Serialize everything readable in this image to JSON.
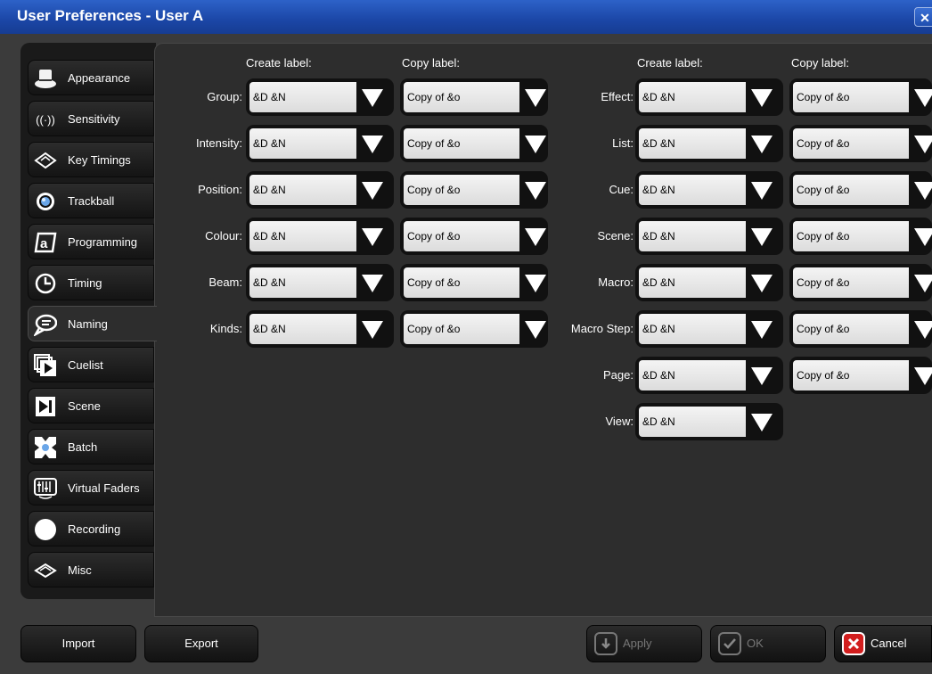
{
  "window": {
    "title": "User Preferences - User A"
  },
  "sidebar": {
    "items": [
      {
        "label": "Appearance",
        "icon": "hat-icon"
      },
      {
        "label": "Sensitivity",
        "icon": "sensitivity-icon"
      },
      {
        "label": "Key Timings",
        "icon": "key-icon"
      },
      {
        "label": "Trackball",
        "icon": "trackball-icon"
      },
      {
        "label": "Programming",
        "icon": "programming-icon"
      },
      {
        "label": "Timing",
        "icon": "clock-icon"
      },
      {
        "label": "Naming",
        "icon": "speech-bubble-icon",
        "active": true
      },
      {
        "label": "Cuelist",
        "icon": "cuelist-icon"
      },
      {
        "label": "Scene",
        "icon": "scene-icon"
      },
      {
        "label": "Batch",
        "icon": "batch-icon"
      },
      {
        "label": "Virtual Faders",
        "icon": "faders-icon"
      },
      {
        "label": "Recording",
        "icon": "record-icon"
      },
      {
        "label": "Misc",
        "icon": "misc-icon"
      }
    ]
  },
  "naming": {
    "headers": {
      "create_label": "Create label:",
      "copy_label": "Copy label:"
    },
    "left_rows": [
      {
        "label": "Group:",
        "create": "&D &N",
        "copy": "Copy of &o"
      },
      {
        "label": "Intensity:",
        "create": "&D &N",
        "copy": "Copy of &o"
      },
      {
        "label": "Position:",
        "create": "&D &N",
        "copy": "Copy of &o"
      },
      {
        "label": "Colour:",
        "create": "&D &N",
        "copy": "Copy of &o"
      },
      {
        "label": "Beam:",
        "create": "&D &N",
        "copy": "Copy of &o"
      },
      {
        "label": "Kinds:",
        "create": "&D &N",
        "copy": "Copy of &o"
      }
    ],
    "right_rows": [
      {
        "label": "Effect:",
        "create": "&D &N",
        "copy": "Copy of &o"
      },
      {
        "label": "List:",
        "create": "&D &N",
        "copy": "Copy of &o"
      },
      {
        "label": "Cue:",
        "create": "&D &N",
        "copy": "Copy of &o"
      },
      {
        "label": "Scene:",
        "create": "&D &N",
        "copy": "Copy of &o"
      },
      {
        "label": "Macro:",
        "create": "&D &N",
        "copy": "Copy of &o"
      },
      {
        "label": "Macro Step:",
        "create": "&D &N",
        "copy": "Copy of &o"
      },
      {
        "label": "Page:",
        "create": "&D &N",
        "copy": "Copy of &o"
      },
      {
        "label": "View:",
        "create": "&D &N"
      }
    ]
  },
  "footer": {
    "import": "Import",
    "export": "Export",
    "apply": "Apply",
    "ok": "OK",
    "cancel": "Cancel"
  }
}
